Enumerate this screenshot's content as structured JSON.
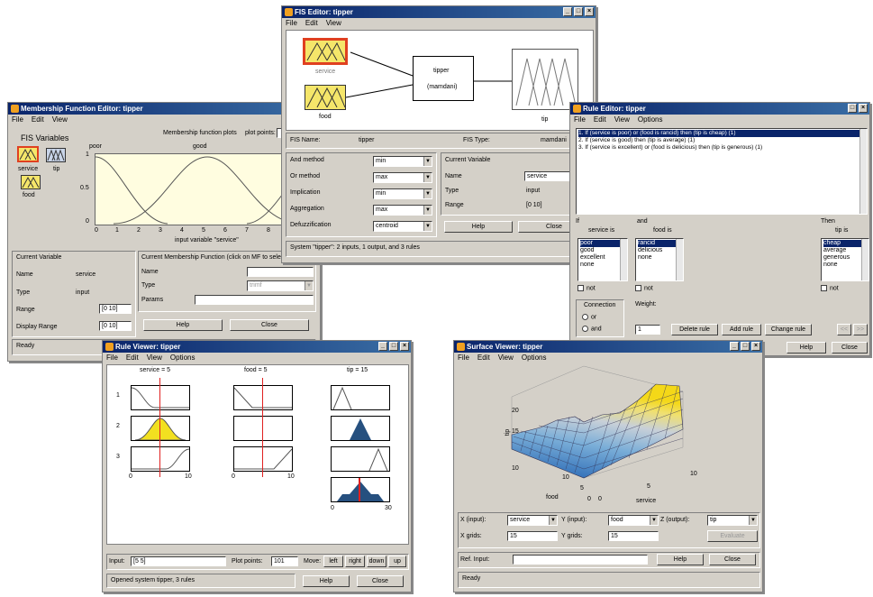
{
  "mf": {
    "title": "Membership Function Editor: tipper",
    "menu": [
      "File",
      "Edit",
      "View"
    ],
    "fis_vars": "FIS Variables",
    "plots_label": "Membership function plots",
    "plot_points": "plot points:",
    "var_service": "service",
    "var_tip": "tip",
    "var_food": "food",
    "curve_poor": "poor",
    "curve_good": "good",
    "yticks": [
      "1",
      "0.5",
      "0"
    ],
    "xticks": [
      "0",
      "1",
      "2",
      "3",
      "4",
      "5",
      "6",
      "7",
      "8"
    ],
    "xlabel": "input variable \"service\"",
    "cv_title": "Current Variable",
    "name_lbl": "Name",
    "name_val": "service",
    "type_lbl": "Type",
    "type_val": "input",
    "range_lbl": "Range",
    "range_val": "[0 10]",
    "drange_lbl": "Display Range",
    "drange_val": "[0 10]",
    "cmf_title": "Current Membership Function (click on MF to select)",
    "mf_name": "Name",
    "mf_type": "Type",
    "mf_type_val": "trimf",
    "mf_params": "Params",
    "help": "Help",
    "close": "Close",
    "status": "Ready"
  },
  "fis": {
    "title": "FIS Editor: tipper",
    "menu": [
      "File",
      "Edit",
      "View"
    ],
    "in1": "service",
    "in2": "food",
    "sys_name": "tipper",
    "sys_type": "(mamdani)",
    "out": "tip",
    "fis_name_lbl": "FIS Name:",
    "fis_name_val": "tipper",
    "fis_type_lbl": "FIS Type:",
    "fis_type_val": "mamdani",
    "methods": [
      {
        "label": "And method",
        "val": "min"
      },
      {
        "label": "Or method",
        "val": "max"
      },
      {
        "label": "Implication",
        "val": "min"
      },
      {
        "label": "Aggregation",
        "val": "max"
      },
      {
        "label": "Defuzzification",
        "val": "centroid"
      }
    ],
    "cv_title": "Current Variable",
    "name_lbl": "Name",
    "name_val": "service",
    "type_lbl": "Type",
    "type_val": "input",
    "range_lbl": "Range",
    "range_val": "[0 10]",
    "help": "Help",
    "close": "Close",
    "status": "System \"tipper\": 2 inputs, 1 output, and 3 rules"
  },
  "rule": {
    "title": "Rule Editor: tipper",
    "menu": [
      "File",
      "Edit",
      "View",
      "Options"
    ],
    "rules": [
      "1. If (service is poor) or (food is rancid) then (tip is cheap) (1)",
      "2. If (service is good) then (tip is average) (1)",
      "3. If (service is excellent) or (food is delicious) then (tip is generous) (1)"
    ],
    "if_lbl": "If",
    "service_is": "service is",
    "and_lbl": "and",
    "food_is": "food is",
    "then_lbl": "Then",
    "tip_is": "tip is",
    "service_opts": [
      "poor",
      "good",
      "excellent",
      "none"
    ],
    "food_opts": [
      "rancid",
      "delicious",
      "none"
    ],
    "tip_opts": [
      "cheap",
      "average",
      "generous",
      "none"
    ],
    "not": "not",
    "connection": "Connection",
    "or": "or",
    "and": "and",
    "weight_lbl": "Weight:",
    "weight_val": "1",
    "delete": "Delete rule",
    "add": "Add rule",
    "change": "Change rule",
    "prev": "<<",
    "next": ">>",
    "help": "Help",
    "close": "Close"
  },
  "rv": {
    "title": "Rule Viewer: tipper",
    "menu": [
      "File",
      "Edit",
      "View",
      "Options"
    ],
    "service_hdr": "service = 5",
    "food_hdr": "food = 5",
    "tip_hdr": "tip = 15",
    "rows": [
      "1",
      "2",
      "3"
    ],
    "s_ticks": [
      "0",
      "10"
    ],
    "f_ticks": [
      "0",
      "10"
    ],
    "t_ticks": [
      "0",
      "30"
    ],
    "input_lbl": "Input:",
    "input_val": "[5 5]",
    "pp_lbl": "Plot points:",
    "pp_val": "101",
    "move_lbl": "Move:",
    "left": "left",
    "right": "right",
    "down": "down",
    "up": "up",
    "status": "Opened system tipper, 3 rules",
    "help": "Help",
    "close": "Close"
  },
  "sv": {
    "title": "Surface Viewer: tipper",
    "menu": [
      "File",
      "Edit",
      "View",
      "Options"
    ],
    "zticks": [
      "20",
      "15",
      "10"
    ],
    "zlabel": "tip",
    "food_ticks": [
      "10",
      "5",
      "0"
    ],
    "serv_ticks": [
      "0",
      "5",
      "10"
    ],
    "food_lbl": "food",
    "service_lbl": "service",
    "x_in_lbl": "X (input):",
    "x_in_val": "service",
    "y_in_lbl": "Y (input):",
    "y_in_val": "food",
    "z_out_lbl": "Z (output):",
    "z_out_val": "tip",
    "xgrids_lbl": "X grids:",
    "xgrids_val": "15",
    "ygrids_lbl": "Y grids:",
    "ygrids_val": "15",
    "evaluate": "Evaluate",
    "ref_lbl": "Ref. Input:",
    "help": "Help",
    "close": "Close",
    "status": "Ready"
  },
  "colors": {
    "title_bar": "#0a246a",
    "plot_bg": "#fffde0",
    "selected": "#e8c24a",
    "tip_fill": "#26507f",
    "marker": "#e02020"
  }
}
